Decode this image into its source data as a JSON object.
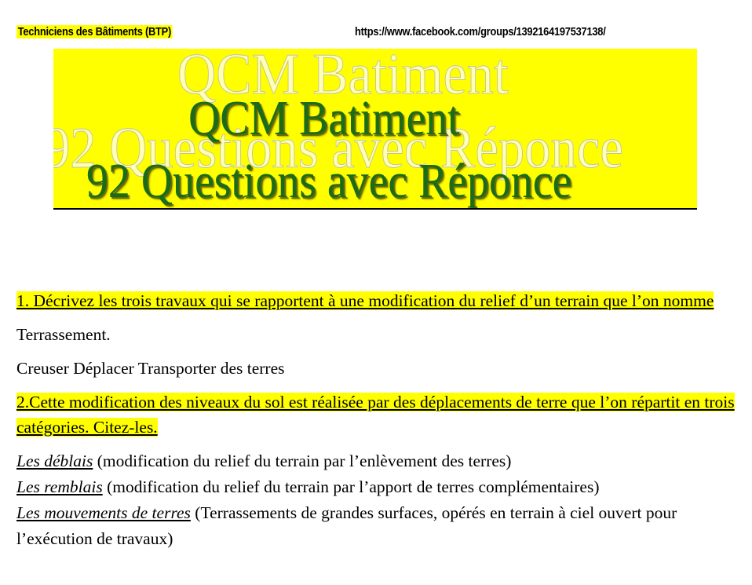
{
  "header": {
    "group_name": "Techniciens des Bâtiments (BTP)",
    "url": "https://www.facebook.com/groups/1392164197537138/"
  },
  "banner": {
    "title_line1": "QCM  Batiment",
    "title_line2": "92 Questions avec Réponce"
  },
  "questions": [
    {
      "question": "1. Décrivez les trois travaux qui se rapportent à une modification du relief d’un terrain que l’on nomme",
      "answer_lines": [
        "Terrassement.",
        "Creuser Déplacer Transporter des terres"
      ]
    },
    {
      "question": "2.Cette modification des niveaux du sol est réalisée par des déplacements de terre que l’on répartit en  trois catégories. Citez-les.",
      "definitions": [
        {
          "term": "Les déblais",
          "text": " (modification du relief du terrain par l’enlèvement des terres)"
        },
        {
          "term": "Les remblais",
          "text": " (modification du relief du terrain par l’apport de terres complémentaires)"
        },
        {
          "term": "Les mouvements de terres",
          "text": " (Terrassements de grandes surfaces, opérés en terrain à ciel ouvert pour l’exécution de travaux)"
        }
      ]
    }
  ],
  "colors": {
    "highlight": "#ffff00",
    "title_green": "#1a6b1a"
  }
}
